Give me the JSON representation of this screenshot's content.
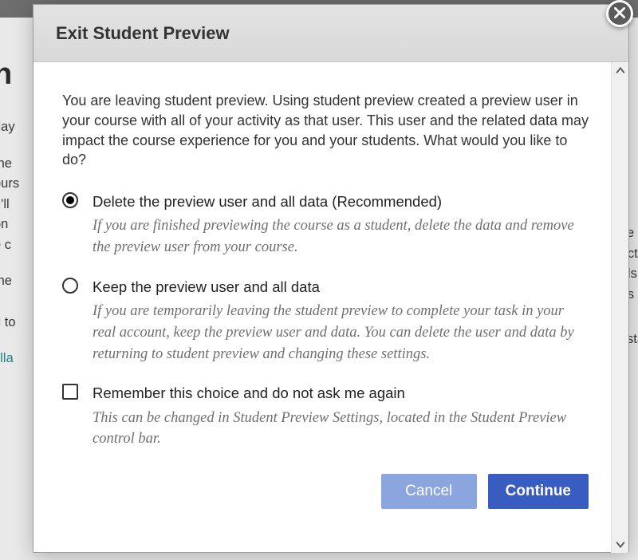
{
  "background": {
    "heading_fragment": "n",
    "para1_a": "day",
    "para2": "the\nours\nu'll\non\ne c",
    "para3": "the\n\nd to",
    "link_text": "ylla",
    "right_1": "ke s\nacti\n als\nas",
    "right_2": "sta"
  },
  "dialog": {
    "title": "Exit Student Preview",
    "intro": "You are leaving student preview. Using student preview created a preview user in your course with all of your activity as that user. This user and the related data may impact the course experience for you and your students. What would you like to do?",
    "options": [
      {
        "label": "Delete the preview user and all data (Recommended)",
        "desc": "If you are finished previewing the course as a student, delete the data and remove the preview user from your course."
      },
      {
        "label": "Keep the preview user and all data",
        "desc": "If you are temporarily leaving the student preview to complete your task in your real account, keep the preview user and data. You can delete the user and data by returning to student preview and changing these settings."
      }
    ],
    "remember": {
      "label": "Remember this choice and do not ask me again",
      "desc": "This can be changed in Student Preview Settings, located in the Student Preview control bar."
    },
    "buttons": {
      "cancel": "Cancel",
      "continue": "Continue"
    }
  }
}
